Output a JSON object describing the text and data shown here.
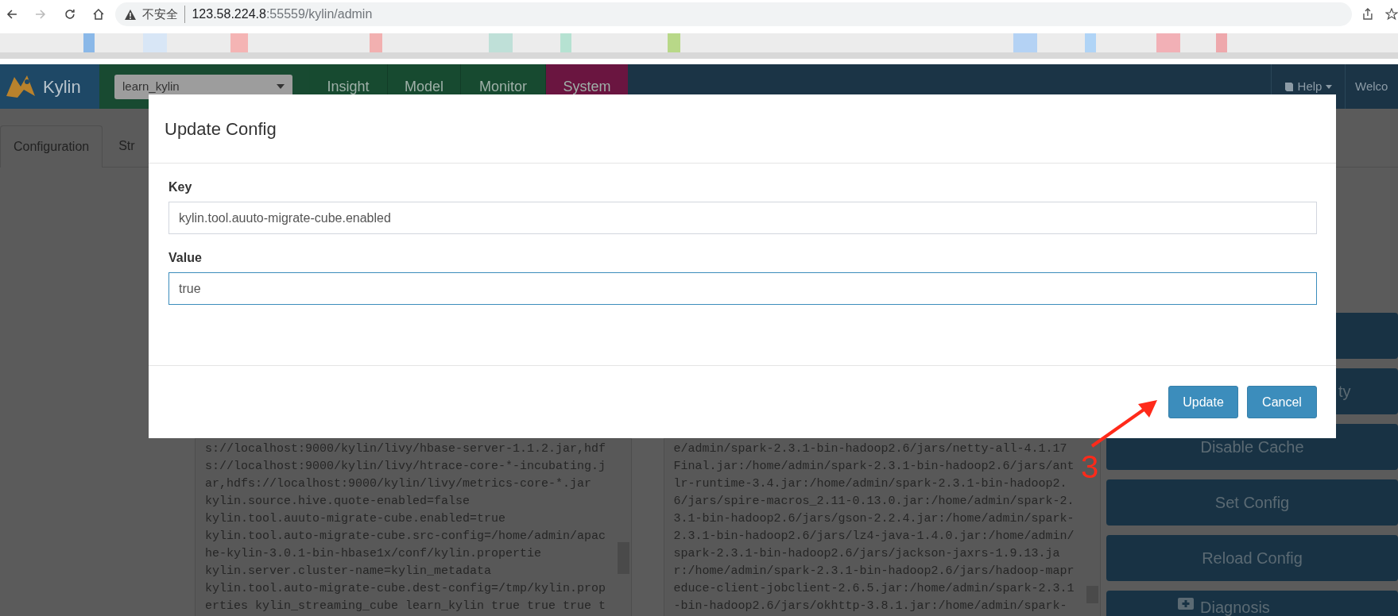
{
  "browser": {
    "address": {
      "security": "不安全",
      "host": "123.58.224.8",
      "path": ":55559/kylin/admin"
    }
  },
  "navbar": {
    "brand": "Kylin",
    "project": "learn_kylin",
    "tabs": [
      {
        "label": "Insight",
        "selected": false
      },
      {
        "label": "Model",
        "selected": false
      },
      {
        "label": "Monitor",
        "selected": false
      },
      {
        "label": "System",
        "selected": true
      }
    ],
    "help": "Help",
    "welcome": "Welco"
  },
  "page_tabs": [
    {
      "label": "Configuration",
      "selected": true
    },
    {
      "label": "Str",
      "selected": false
    }
  ],
  "config_text": [
    "s://localhost:9000/kylin/livy/hbase-server-1.1.2.jar,hdf",
    "s://localhost:9000/kylin/livy/htrace-core-*-incubating.j",
    "ar,hdfs://localhost:9000/kylin/livy/metrics-core-*.jar",
    "kylin.source.hive.quote-enabled=false",
    "kylin.tool.auuto-migrate-cube.enabled=true",
    "kylin.tool.auto-migrate-cube.src-config=/home/admin/apac",
    "he-kylin-3.0.1-bin-hbase1x/conf/kylin.propertie",
    "kylin.server.cluster-name=kylin_metadata",
    "kylin.tool.auto-migrate-cube.dest-config=/tmp/kylin.prop",
    "erties kylin_streaming_cube learn_kylin true true true t"
  ],
  "env_text": [
    "e/admin/spark-2.3.1-bin-hadoop2.6/jars/netty-all-4.1.17",
    "Final.jar:/home/admin/spark-2.3.1-bin-hadoop2.6/jars/ant",
    "lr-runtime-3.4.jar:/home/admin/spark-2.3.1-bin-hadoop2.",
    "6/jars/spire-macros_2.11-0.13.0.jar:/home/admin/spark-2.",
    "3.1-bin-hadoop2.6/jars/gson-2.2.4.jar:/home/admin/spark-",
    "2.3.1-bin-hadoop2.6/jars/lz4-java-1.4.0.jar:/home/admin/",
    "spark-2.3.1-bin-hadoop2.6/jars/jackson-jaxrs-1.9.13.ja",
    "r:/home/admin/spark-2.3.1-bin-hadoop2.6/jars/hadoop-mapr",
    "educe-client-jobclient-2.6.5.jar:/home/admin/spark-2.3.1",
    "-bin-hadoop2.6/jars/okhttp-3.8.1.jar:/home/admin/spark-"
  ],
  "actions": [
    {
      "label": "ty",
      "kind": "clipped"
    },
    {
      "label": "Disable Cache",
      "kind": "plain"
    },
    {
      "label": "Set Config",
      "kind": "plain"
    },
    {
      "label": "Reload Config",
      "kind": "plain"
    },
    {
      "label": "Diagnosis",
      "kind": "diagnosis"
    }
  ],
  "modal": {
    "title": "Update Config",
    "fields": [
      {
        "label": "Key",
        "value": "kylin.tool.auuto-migrate-cube.enabled",
        "focused": false
      },
      {
        "label": "Value",
        "value": "true",
        "focused": true
      }
    ],
    "buttons": [
      "Update",
      "Cancel"
    ]
  },
  "annotation": {
    "number": "3"
  }
}
